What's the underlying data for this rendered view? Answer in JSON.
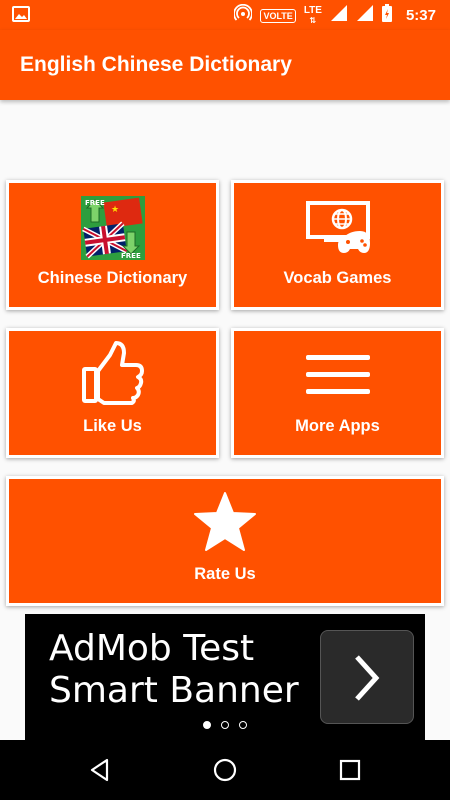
{
  "status_bar": {
    "volte": "VOLTE",
    "lte": "LTE",
    "time": "5:37",
    "icons": [
      "image-icon",
      "hotspot-icon",
      "signal-icon",
      "battery-icon"
    ]
  },
  "app_bar": {
    "title": "English Chinese Dictionary"
  },
  "tiles": [
    {
      "label": "Chinese Dictionary",
      "icon": "flags-dictionary-icon",
      "badge_top": "FREE",
      "badge_bottom": "FREE"
    },
    {
      "label": "Vocab Games",
      "icon": "web-gamepad-icon"
    },
    {
      "label": "Like Us",
      "icon": "thumbs-up-icon"
    },
    {
      "label": "More Apps",
      "icon": "menu-lines-icon"
    },
    {
      "label": "Rate Us",
      "icon": "star-icon"
    }
  ],
  "ad": {
    "line1": "AdMob Test",
    "line2": "Smart Banner",
    "button_icon": "chevron-right-icon"
  },
  "nav_bar": {
    "icons": [
      "back-icon",
      "home-icon",
      "recents-icon"
    ]
  },
  "colors": {
    "primary": "#ff5100",
    "tile_border": "#ffffff",
    "ad_background": "#000000"
  }
}
